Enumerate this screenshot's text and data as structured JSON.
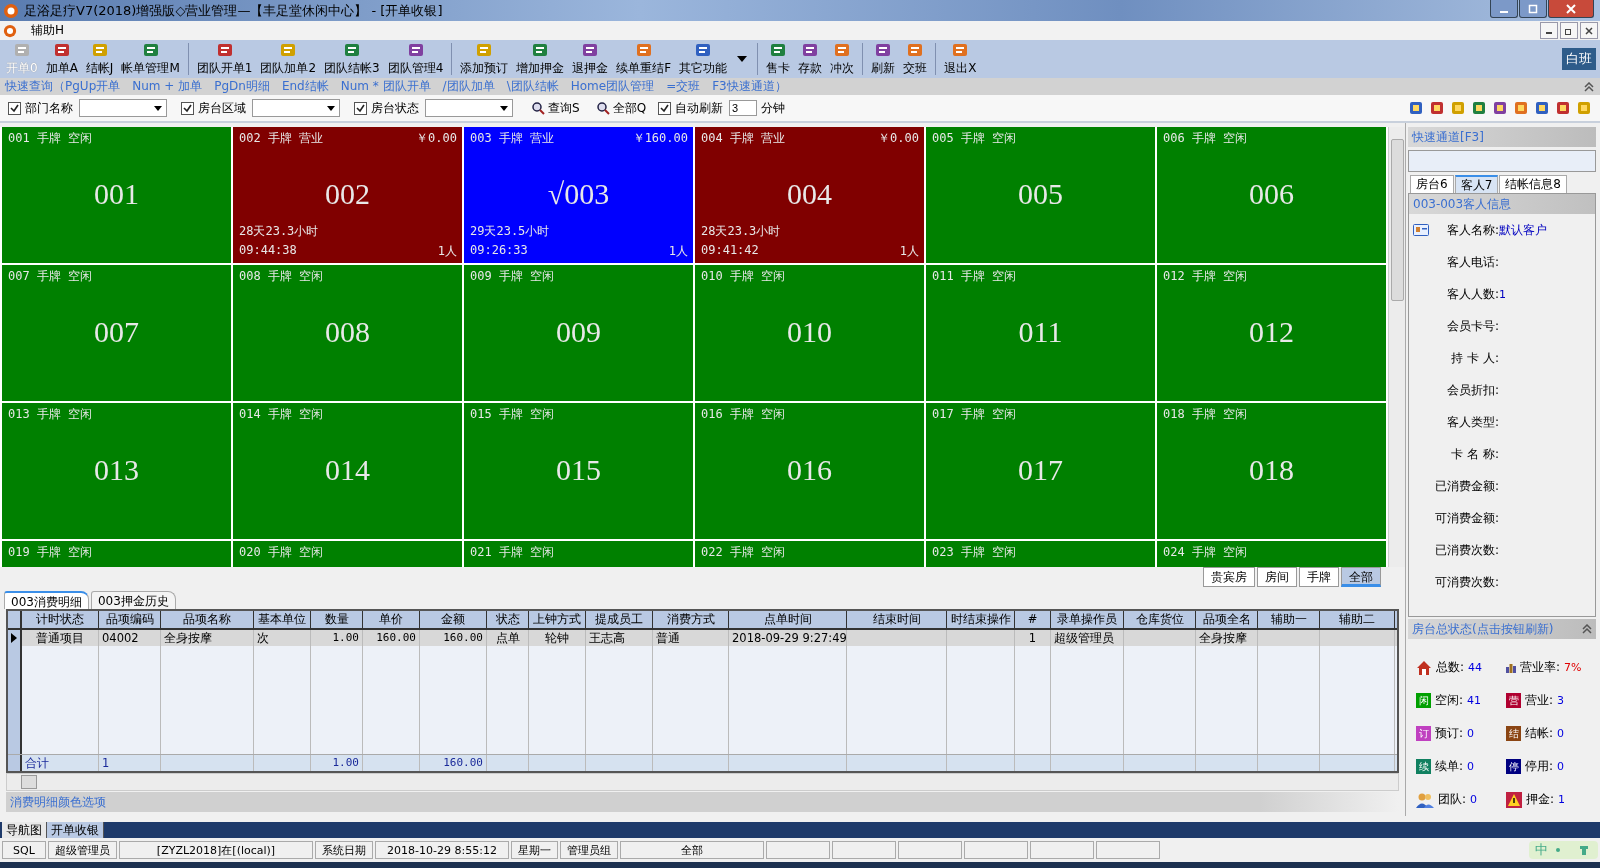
{
  "window": {
    "title": "足浴足疗V7(2018)增强版◇营业管理—【丰足堂休闲中心】 - [开单收银]"
  },
  "menu": [
    "辅助H"
  ],
  "toolbar": [
    [
      {
        "label": "开单0",
        "disabled": true
      },
      {
        "label": "加单A",
        "disabled": false
      },
      {
        "label": "结帐J",
        "disabled": false
      },
      {
        "label": "帐单管理M",
        "disabled": false
      }
    ],
    [
      {
        "label": "团队开单1",
        "disabled": false
      },
      {
        "label": "团队加单2",
        "disabled": false
      },
      {
        "label": "团队结帐3",
        "disabled": false
      },
      {
        "label": "团队管理4",
        "disabled": false
      }
    ],
    [
      {
        "label": "添加预订",
        "disabled": false
      },
      {
        "label": "增加押金",
        "disabled": false
      },
      {
        "label": "退押金",
        "disabled": false
      },
      {
        "label": "续单重结F",
        "disabled": false
      },
      {
        "label": "其它功能",
        "disabled": false
      }
    ],
    [
      {
        "label": "售卡",
        "disabled": false
      },
      {
        "label": "存款",
        "disabled": false
      },
      {
        "label": "冲次",
        "disabled": false
      }
    ],
    [
      {
        "label": "刷新",
        "disabled": false
      },
      {
        "label": "交班",
        "disabled": false
      }
    ],
    [
      {
        "label": "退出X",
        "disabled": false
      }
    ]
  ],
  "shift": "白班",
  "quick_keys": "快速查询（PgUp开单　Num + 加单　PgDn明细　End结帐　Num * 团队开单　/团队加单　\\团队结帐　Home团队管理　=交班　F3快速通道）",
  "filters": [
    {
      "label": "部门名称",
      "checked": true
    },
    {
      "label": "房台区域",
      "checked": true
    },
    {
      "label": "房台状态",
      "checked": true
    }
  ],
  "query_buttons": [
    "查询S",
    "全部Q"
  ],
  "auto_refresh": {
    "label": "自动刷新",
    "checked": true,
    "value": "3",
    "unit": "分钟"
  },
  "rooms": [
    {
      "code": "001",
      "tag": "手牌",
      "state": "空闲",
      "occupied": false,
      "selected": false,
      "label": "001"
    },
    {
      "code": "002",
      "tag": "手牌",
      "state": "营业",
      "occupied": true,
      "selected": false,
      "label": "002",
      "amount": "￥0.00",
      "duration": "28天23.3小时",
      "time": "09:44:38",
      "people": "1人"
    },
    {
      "code": "003",
      "tag": "手牌",
      "state": "营业",
      "occupied": true,
      "selected": true,
      "mark": "√",
      "label": "003",
      "amount": "￥160.00",
      "duration": "29天23.5小时",
      "time": "09:26:33",
      "people": "1人"
    },
    {
      "code": "004",
      "tag": "手牌",
      "state": "营业",
      "occupied": true,
      "selected": false,
      "label": "004",
      "amount": "￥0.00",
      "duration": "28天23.3小时",
      "time": "09:41:42",
      "people": "1人"
    },
    {
      "code": "005",
      "tag": "手牌",
      "state": "空闲",
      "occupied": false,
      "selected": false,
      "label": "005"
    },
    {
      "code": "006",
      "tag": "手牌",
      "state": "空闲",
      "occupied": false,
      "selected": false,
      "label": "006"
    },
    {
      "code": "007",
      "tag": "手牌",
      "state": "空闲",
      "occupied": false,
      "selected": false,
      "label": "007"
    },
    {
      "code": "008",
      "tag": "手牌",
      "state": "空闲",
      "occupied": false,
      "selected": false,
      "label": "008"
    },
    {
      "code": "009",
      "tag": "手牌",
      "state": "空闲",
      "occupied": false,
      "selected": false,
      "label": "009"
    },
    {
      "code": "010",
      "tag": "手牌",
      "state": "空闲",
      "occupied": false,
      "selected": false,
      "label": "010"
    },
    {
      "code": "011",
      "tag": "手牌",
      "state": "空闲",
      "occupied": false,
      "selected": false,
      "label": "011"
    },
    {
      "code": "012",
      "tag": "手牌",
      "state": "空闲",
      "occupied": false,
      "selected": false,
      "label": "012"
    },
    {
      "code": "013",
      "tag": "手牌",
      "state": "空闲",
      "occupied": false,
      "selected": false,
      "label": "013"
    },
    {
      "code": "014",
      "tag": "手牌",
      "state": "空闲",
      "occupied": false,
      "selected": false,
      "label": "014"
    },
    {
      "code": "015",
      "tag": "手牌",
      "state": "空闲",
      "occupied": false,
      "selected": false,
      "label": "015"
    },
    {
      "code": "016",
      "tag": "手牌",
      "state": "空闲",
      "occupied": false,
      "selected": false,
      "label": "016"
    },
    {
      "code": "017",
      "tag": "手牌",
      "state": "空闲",
      "occupied": false,
      "selected": false,
      "label": "017"
    },
    {
      "code": "018",
      "tag": "手牌",
      "state": "空闲",
      "occupied": false,
      "selected": false,
      "label": "018"
    },
    {
      "code": "019",
      "tag": "手牌",
      "state": "空闲",
      "occupied": false,
      "selected": false
    },
    {
      "code": "020",
      "tag": "手牌",
      "state": "空闲",
      "occupied": false,
      "selected": false
    },
    {
      "code": "021",
      "tag": "手牌",
      "state": "空闲",
      "occupied": false,
      "selected": false
    },
    {
      "code": "022",
      "tag": "手牌",
      "state": "空闲",
      "occupied": false,
      "selected": false
    },
    {
      "code": "023",
      "tag": "手牌",
      "state": "空闲",
      "occupied": false,
      "selected": false
    },
    {
      "code": "024",
      "tag": "手牌",
      "state": "空闲",
      "occupied": false,
      "selected": false
    }
  ],
  "view_tabs": [
    {
      "label": "贵宾房",
      "selected": false
    },
    {
      "label": "房间",
      "selected": false
    },
    {
      "label": "手牌",
      "selected": false
    },
    {
      "label": "全部",
      "selected": true
    }
  ],
  "detail_tabs": [
    {
      "label": "003消费明细",
      "selected": true
    },
    {
      "label": "003押金历史",
      "selected": false
    }
  ],
  "table": {
    "columns": [
      "计时状态",
      "品项编码",
      "品项名称",
      "基本单位",
      "数量",
      "单价",
      "金额",
      "状态",
      "上钟方式",
      "提成员工",
      "消费方式",
      "点单时间",
      "结束时间",
      "时结束操作",
      "#",
      "录单操作员",
      "仓库货位",
      "品项全名",
      "辅助一",
      "辅助二"
    ],
    "rows": [
      {
        "selected": true,
        "timing": "普通项目",
        "code": "04002",
        "name": "全身按摩",
        "unit": "次",
        "qty": "1.00",
        "price": "160.00",
        "amount": "160.00",
        "status": "点单",
        "clock_mode": "轮钟",
        "staff": "王志高",
        "pay_mode": "普通",
        "order_time": "2018-09-29 9:27:49",
        "seq": "1",
        "operator": "超级管理员",
        "full_name": "全身按摩"
      }
    ],
    "totals": {
      "timing": "合计",
      "code": "1",
      "qty": "1.00",
      "amount": "160.00"
    }
  },
  "color_options": "消费明细颜色选项",
  "right_panel": {
    "quick_channel": "快速通道[F3]",
    "tabs": [
      {
        "label": "房台6",
        "selected": false
      },
      {
        "label": "客人7",
        "selected": true
      },
      {
        "label": "结帐信息8",
        "selected": false
      }
    ],
    "guest_title": "003-003客人信息",
    "fields": [
      {
        "label": "客人名称:",
        "value": "默认客户"
      },
      {
        "label": "客人电话:"
      },
      {
        "label": "客人人数:",
        "value": "1"
      },
      {
        "label": "会员卡号:"
      },
      {
        "label": "持 卡 人:"
      },
      {
        "label": "会员折扣:"
      },
      {
        "label": "客人类型:"
      },
      {
        "label": "卡 名 称:"
      },
      {
        "label": "已消费金额:"
      },
      {
        "label": "可消费金额:"
      },
      {
        "label": "已消费次数:"
      },
      {
        "label": "可消费次数:"
      }
    ],
    "status_title": "房台总状态(点击按钮刷新)",
    "status_items": [
      {
        "kind": "house",
        "label": "总数:",
        "value": "44",
        "alert": false
      },
      {
        "kind": "chart",
        "label": "营业率:",
        "value": "7%",
        "alert": true
      },
      {
        "kind": "badge",
        "badge": "闲",
        "color": "#00a000",
        "label": "空闲:",
        "value": "41",
        "alert": false
      },
      {
        "kind": "badge",
        "badge": "营",
        "color": "#b00030",
        "label": "营业:",
        "value": "3",
        "alert": false
      },
      {
        "kind": "badge",
        "badge": "订",
        "color": "#c040c0",
        "label": "预订:",
        "value": "0",
        "alert": false
      },
      {
        "kind": "badge",
        "badge": "结",
        "color": "#8b4513",
        "label": "结帐:",
        "value": "0",
        "alert": false
      },
      {
        "kind": "badge",
        "badge": "续",
        "color": "#108060",
        "label": "续单:",
        "value": "0",
        "alert": false
      },
      {
        "kind": "badge",
        "badge": "停",
        "color": "#000080",
        "label": "停用:",
        "value": "0",
        "alert": false
      },
      {
        "kind": "people",
        "label": "团队:",
        "value": "0",
        "alert": false
      },
      {
        "kind": "warning",
        "label": "押金:",
        "value": "1",
        "alert": false
      }
    ]
  },
  "nav_tabs": [
    {
      "label": "导航图",
      "selected": false
    },
    {
      "label": "开单收银",
      "selected": true
    }
  ],
  "status_bar": [
    "SQL",
    "超级管理员",
    "[ZYZL2018]在[(local)]",
    "系统日期",
    "2018-10-29  8:55:12",
    "星期一",
    "管理员组",
    "全部"
  ],
  "ime": "中"
}
